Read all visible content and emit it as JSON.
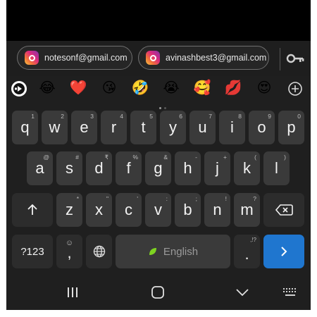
{
  "suggestions": {
    "accounts": [
      {
        "email": "notesonf@gmail.com",
        "icon": "instagram-icon"
      },
      {
        "email": "avinashbest3@gmail.com",
        "icon": "instagram-icon"
      }
    ],
    "password_icon": "key-icon"
  },
  "emoji_bar": {
    "items": [
      "😂",
      "❤️",
      "😘",
      "🤣",
      "😭",
      "🥰",
      "💋",
      "😍"
    ],
    "add_icon": "plus-circle-icon",
    "app_icon": "sticker-app-icon"
  },
  "keyboard": {
    "row1": [
      {
        "label": "q",
        "hint": "1"
      },
      {
        "label": "w",
        "hint": "2"
      },
      {
        "label": "e",
        "hint": "3"
      },
      {
        "label": "r",
        "hint": "4"
      },
      {
        "label": "t",
        "hint": "5"
      },
      {
        "label": "y",
        "hint": "6"
      },
      {
        "label": "u",
        "hint": "7"
      },
      {
        "label": "i",
        "hint": "8"
      },
      {
        "label": "o",
        "hint": "9"
      },
      {
        "label": "p",
        "hint": "0"
      }
    ],
    "row2": [
      {
        "label": "a",
        "hint": "@"
      },
      {
        "label": "s",
        "hint": "#"
      },
      {
        "label": "d",
        "hint": "₹"
      },
      {
        "label": "f",
        "hint": "%"
      },
      {
        "label": "g",
        "hint": "&"
      },
      {
        "label": "h",
        "hint": "-"
      },
      {
        "label": "j",
        "hint": "+"
      },
      {
        "label": "k",
        "hint": "("
      },
      {
        "label": "l",
        "hint": ")"
      }
    ],
    "row3": [
      {
        "label": "z",
        "hint": "*"
      },
      {
        "label": "x",
        "hint": "\""
      },
      {
        "label": "c",
        "hint": "'"
      },
      {
        "label": "v",
        "hint": ":"
      },
      {
        "label": "b",
        "hint": ";"
      },
      {
        "label": "n",
        "hint": "!"
      },
      {
        "label": "m",
        "hint": "?"
      }
    ],
    "shift_icon": "shift-arrow-icon",
    "backspace_icon": "backspace-icon",
    "symbols_label": "?123",
    "comma_label": ",",
    "comma_hint": "☺",
    "globe_icon": "globe-icon",
    "space_label": "English",
    "space_icon": "leaf-icon",
    "period_label": ".",
    "period_hint": ",!?",
    "enter_icon": "chevron-right-icon",
    "enter_color": "#1f76cf"
  },
  "navigation": {
    "recents_icon": "recents-icon",
    "home_icon": "home-icon",
    "back_icon": "chevron-down-icon",
    "keyboard_switch_icon": "keyboard-icon"
  }
}
